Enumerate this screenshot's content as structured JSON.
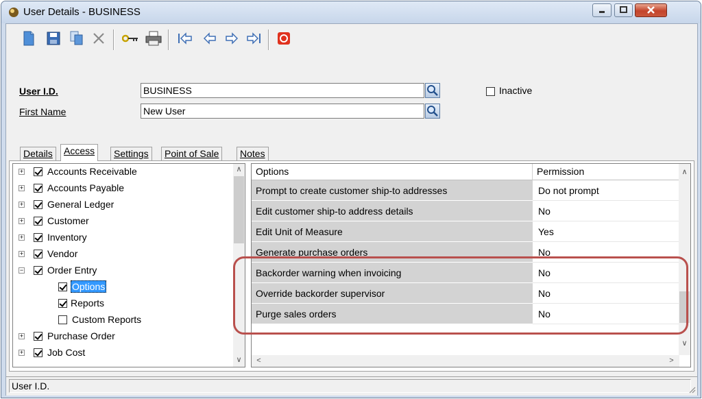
{
  "window": {
    "title": "User Details - BUSINESS",
    "controls": [
      "minimize",
      "maximize",
      "close"
    ]
  },
  "toolbar": {
    "buttons": [
      "new",
      "save",
      "copy",
      "delete",
      "password-key",
      "print",
      "first",
      "previous",
      "next",
      "last",
      "exit"
    ]
  },
  "form": {
    "user_id_label": "User I.D.",
    "user_id_value": "BUSINESS",
    "first_name_label": "First Name",
    "first_name_value": "New User",
    "inactive_label": "Inactive",
    "inactive_checked": false
  },
  "tabs": [
    {
      "label": "Details",
      "active": false
    },
    {
      "label": "Access",
      "active": true
    },
    {
      "label": "Settings",
      "active": false
    },
    {
      "label": "Point of Sale",
      "active": false
    },
    {
      "label": "Notes",
      "active": false
    }
  ],
  "tree": {
    "items": [
      {
        "label": "Accounts Receivable",
        "checked": true,
        "expander": "+"
      },
      {
        "label": "Accounts Payable",
        "checked": true,
        "expander": "+"
      },
      {
        "label": "General Ledger",
        "checked": true,
        "expander": "+"
      },
      {
        "label": "Customer",
        "checked": true,
        "expander": "+"
      },
      {
        "label": "Inventory",
        "checked": true,
        "expander": "+"
      },
      {
        "label": "Vendor",
        "checked": true,
        "expander": "+"
      },
      {
        "label": "Order Entry",
        "checked": true,
        "expander": "−"
      },
      {
        "label": "Options",
        "checked": true,
        "child": true,
        "selected": true
      },
      {
        "label": "Reports",
        "checked": true,
        "child": true
      },
      {
        "label": "Custom Reports",
        "checked": false,
        "child": true
      },
      {
        "label": "Purchase Order",
        "checked": true,
        "expander": "+"
      },
      {
        "label": "Job Cost",
        "checked": true,
        "expander": "+"
      }
    ]
  },
  "grid": {
    "columns": [
      "Options",
      "Permission"
    ],
    "rows": [
      {
        "option": "Prompt to create customer ship-to addresses",
        "permission": "Do not prompt"
      },
      {
        "option": "Edit customer ship-to address details",
        "permission": "No"
      },
      {
        "option": "Edit Unit of Measure",
        "permission": "Yes"
      },
      {
        "option": "Generate purchase orders",
        "permission": "No"
      },
      {
        "option": "Backorder warning when invoicing",
        "permission": "No"
      },
      {
        "option": "Override backorder supervisor",
        "permission": "No"
      },
      {
        "option": "Purge sales orders",
        "permission": "No"
      }
    ]
  },
  "status": {
    "text": "User I.D."
  },
  "colors": {
    "highlight": "#b9504d",
    "selection": "#3399ff",
    "exit_icon": "#e0321e"
  }
}
